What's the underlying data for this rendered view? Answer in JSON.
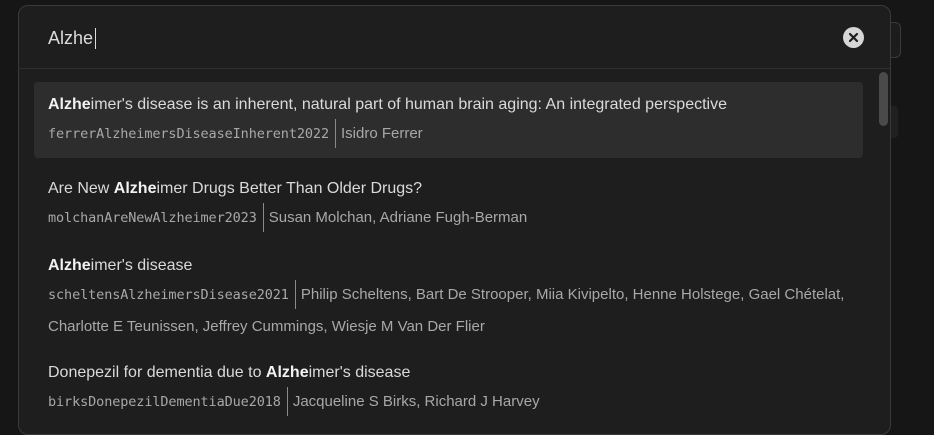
{
  "search": {
    "value": "Alzhe",
    "clear_icon": "close-circle-icon"
  },
  "results": [
    {
      "title_prefix": "",
      "title_match": "Alzhe",
      "title_suffix": "imer's disease is an inherent, natural part of human brain aging: An integrated perspective",
      "citekey": "ferrerAlzheimersDiseaseInherent2022",
      "authors": "Isidro Ferrer"
    },
    {
      "title_prefix": "Are New ",
      "title_match": "Alzhe",
      "title_suffix": "imer Drugs Better Than Older Drugs?",
      "citekey": "molchanAreNewAlzheimer2023",
      "authors": "Susan Molchan, Adriane Fugh-Berman"
    },
    {
      "title_prefix": "",
      "title_match": "Alzhe",
      "title_suffix": "imer's disease",
      "citekey": "scheltensAlzheimersDisease2021",
      "authors": "Philip Scheltens, Bart De Strooper, Miia Kivipelto, Henne Holstege, Gael Chételat, Charlotte E Teunissen, Jeffrey Cummings, Wiesje M Van Der Flier"
    },
    {
      "title_prefix": "Donepezil for dementia due to ",
      "title_match": "Alzhe",
      "title_suffix": "imer's disease",
      "citekey": "birksDonepezilDementiaDue2018",
      "authors": "Jacqueline S Birks, Richard J Harvey"
    }
  ]
}
